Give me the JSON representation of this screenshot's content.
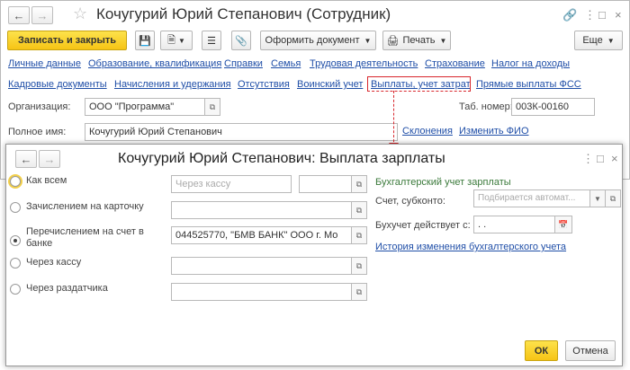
{
  "main": {
    "title": "Кочугурий Юрий Степанович (Сотрудник)",
    "toolbar": {
      "save_close": "Записать и закрыть",
      "create_doc": "Оформить документ",
      "print": "Печать",
      "more": "Еще"
    },
    "links_row1": [
      "Личные данные",
      "Образование, квалификация",
      "Справки",
      "Семья",
      "Трудовая деятельность",
      "Страхование",
      "Налог на доходы"
    ],
    "links_row2": [
      "Кадровые документы",
      "Начисления и удержания",
      "Отсутствия",
      "Воинский учет",
      "Выплаты, учет затрат",
      "Прямые выплаты ФСС"
    ],
    "org_label": "Организация:",
    "org_value": "ООО \"Программа\"",
    "tab_label": "Таб. номер:",
    "tab_value": "003К-00160",
    "fullname_label": "Полное имя:",
    "fullname_value": "Кочугурий Юрий Степанович",
    "declension_link": "Склонения",
    "change_fio_link": "Изменить ФИО"
  },
  "dialog": {
    "title": "Кочугурий Юрий Степанович: Выплата зарплаты",
    "options": [
      "Как всем",
      "Зачислением на карточку",
      "Перечислением на счет в банке",
      "Через кассу",
      "Через раздатчика"
    ],
    "selected_option": "Перечислением на счет в банке",
    "via_cashbox_placeholder": "Через кассу",
    "bank_value": "044525770, \"БМВ БАНК\" ООО г. Мо",
    "accounting_title": "Бухгалтерский учет зарплаты",
    "account_label": "Счет, субконто:",
    "account_placeholder": "Подбирается автомат...",
    "effective_label": "Бухучет действует с:",
    "effective_value": " .  .",
    "history_link": "История изменения бухгалтерского учета",
    "ok": "ОК",
    "cancel": "Отмена"
  },
  "colors": {
    "accent_yellow": "#f6c415",
    "link_blue": "#1f4ea7",
    "section_green": "#3b7a3b",
    "annotation_red": "#d8262c"
  }
}
